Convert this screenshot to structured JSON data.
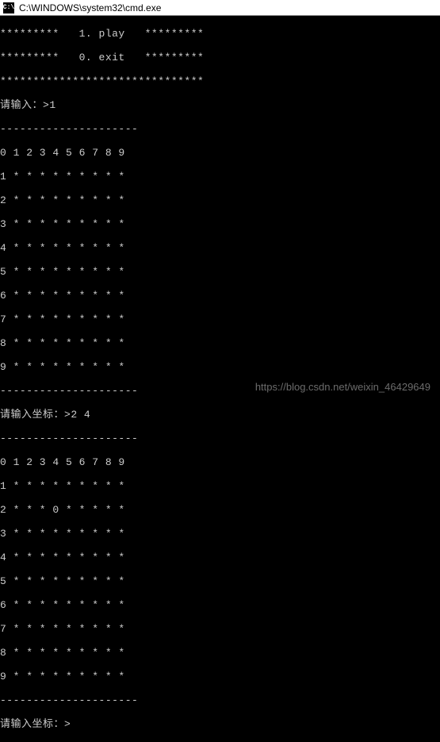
{
  "window": {
    "icon_label": "C:\\",
    "title": "C:\\WINDOWS\\system32\\cmd.exe"
  },
  "menu": {
    "line1": "*********   1. play   *********",
    "line2": "*********   0. exit   *********",
    "line3": "*******************************"
  },
  "prompt1": {
    "label": "请输入：>",
    "input": "1"
  },
  "board1": {
    "separator_top": "---------------------",
    "header": "0 1 2 3 4 5 6 7 8 9",
    "rows": [
      "1 * * * * * * * * *",
      "2 * * * * * * * * *",
      "3 * * * * * * * * *",
      "4 * * * * * * * * *",
      "5 * * * * * * * * *",
      "6 * * * * * * * * *",
      "7 * * * * * * * * *",
      "8 * * * * * * * * *",
      "9 * * * * * * * * *"
    ],
    "separator_bottom": "---------------------"
  },
  "prompt2": {
    "label": "请输入坐标：>",
    "input": "2 4"
  },
  "board2": {
    "separator_top": "---------------------",
    "header": "0 1 2 3 4 5 6 7 8 9",
    "rows": [
      "1 * * * * * * * * *",
      "2 * * * 0 * * * * *",
      "3 * * * * * * * * *",
      "4 * * * * * * * * *",
      "5 * * * * * * * * *",
      "6 * * * * * * * * *",
      "7 * * * * * * * * *",
      "8 * * * * * * * * *",
      "9 * * * * * * * * *"
    ],
    "separator_bottom": "---------------------"
  },
  "prompt3": {
    "label": "请输入坐标：>",
    "input": ""
  },
  "watermark": "https://blog.csdn.net/weixin_46429649"
}
